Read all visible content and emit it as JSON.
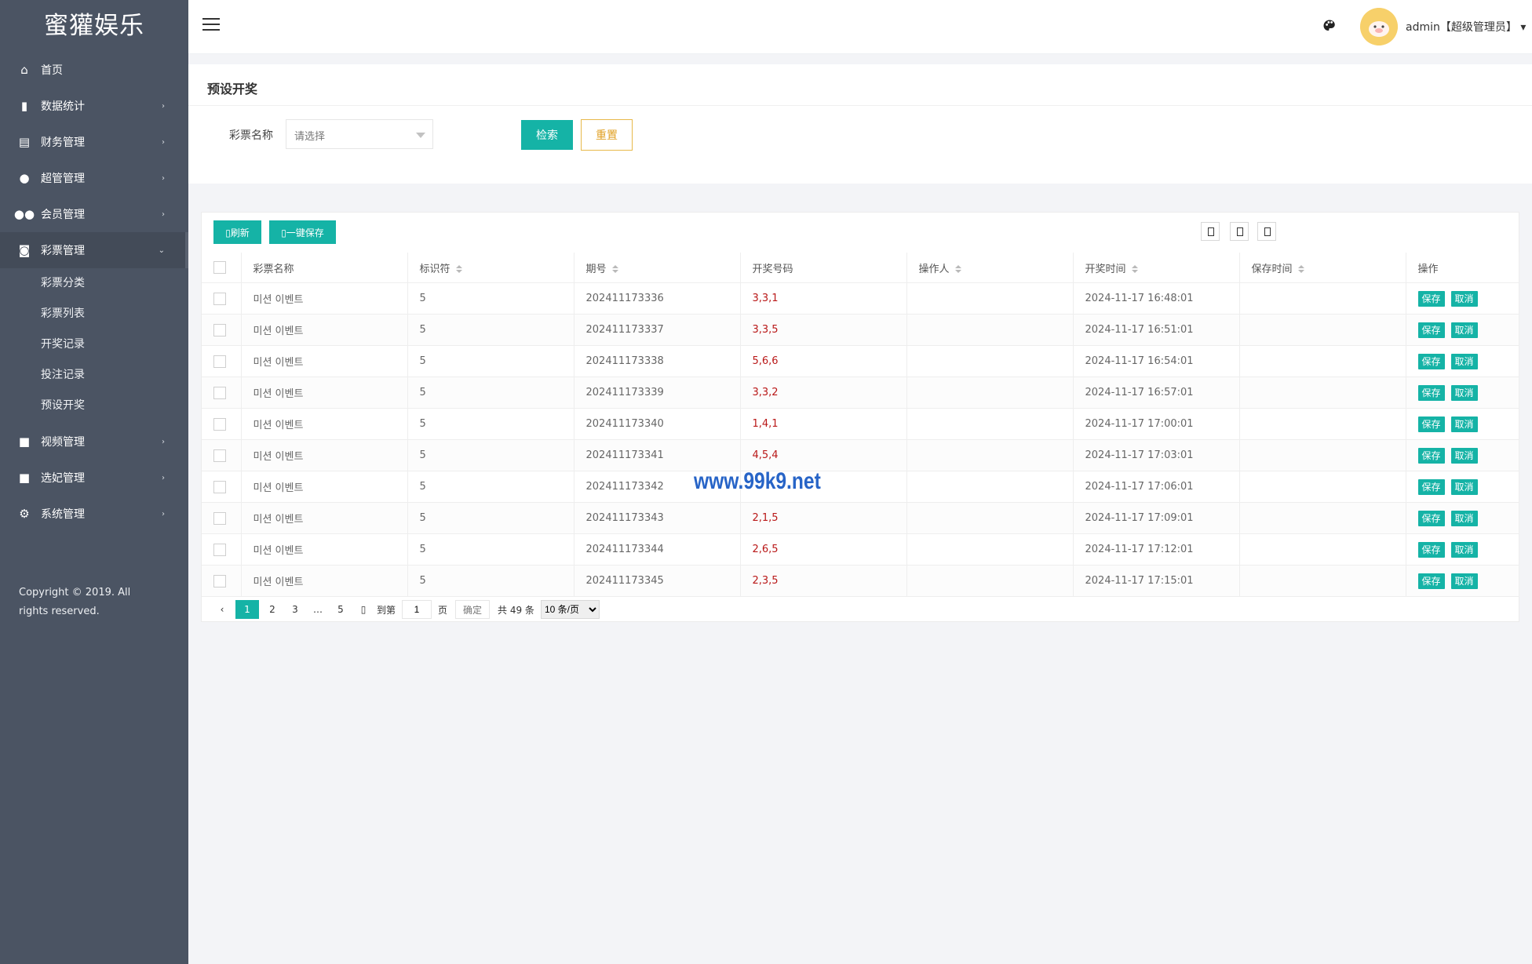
{
  "sidebar": {
    "logo": "蜜獾娱乐",
    "items": [
      {
        "label": "首页",
        "icon": "home-icon",
        "arrow": ""
      },
      {
        "label": "数据统计",
        "icon": "bar-chart-icon",
        "arrow": "›"
      },
      {
        "label": "财务管理",
        "icon": "bank-icon",
        "arrow": "›"
      },
      {
        "label": "超管管理",
        "icon": "user-icon",
        "arrow": "›"
      },
      {
        "label": "会员管理",
        "icon": "users-icon",
        "arrow": "›"
      },
      {
        "label": "彩票管理",
        "icon": "gamepad-icon",
        "arrow": "⌄"
      }
    ],
    "sub_items": [
      "彩票分类",
      "彩票列表",
      "开奖记录",
      "投注记录",
      "预设开奖"
    ],
    "items_after": [
      {
        "label": "视频管理",
        "icon": "video-icon",
        "arrow": "›"
      },
      {
        "label": "选妃管理",
        "icon": "video-icon",
        "arrow": "›"
      },
      {
        "label": "系统管理",
        "icon": "gear-icon",
        "arrow": "›"
      }
    ],
    "copyright": "Copyright © 2019. All rights reserved."
  },
  "topbar": {
    "user": "admin【超级管理员】",
    "user_caret": "▾"
  },
  "search": {
    "title": "预设开奖",
    "field_label": "彩票名称",
    "placeholder": "请选择",
    "search_label": "检索",
    "reset_label": "重置"
  },
  "table": {
    "refresh_label": "刷新",
    "save_all_label": "一键保存",
    "headers": [
      "彩票名称",
      "标识符",
      "期号",
      "开奖号码",
      "操作人",
      "开奖时间",
      "保存时间",
      "操作"
    ],
    "rows": [
      {
        "name": "미션 이벤트",
        "id": "5",
        "issue": "202411173336",
        "numbers": "3,3,1",
        "operator": "",
        "open_time": "2024-11-17 16:48:01",
        "save_time": ""
      },
      {
        "name": "미션 이벤트",
        "id": "5",
        "issue": "202411173337",
        "numbers": "3,3,5",
        "operator": "",
        "open_time": "2024-11-17 16:51:01",
        "save_time": ""
      },
      {
        "name": "미션 이벤트",
        "id": "5",
        "issue": "202411173338",
        "numbers": "5,6,6",
        "operator": "",
        "open_time": "2024-11-17 16:54:01",
        "save_time": ""
      },
      {
        "name": "미션 이벤트",
        "id": "5",
        "issue": "202411173339",
        "numbers": "3,3,2",
        "operator": "",
        "open_time": "2024-11-17 16:57:01",
        "save_time": ""
      },
      {
        "name": "미션 이벤트",
        "id": "5",
        "issue": "202411173340",
        "numbers": "1,4,1",
        "operator": "",
        "open_time": "2024-11-17 17:00:01",
        "save_time": ""
      },
      {
        "name": "미션 이벤트",
        "id": "5",
        "issue": "202411173341",
        "numbers": "4,5,4",
        "operator": "",
        "open_time": "2024-11-17 17:03:01",
        "save_time": ""
      },
      {
        "name": "미션 이벤트",
        "id": "5",
        "issue": "202411173342",
        "numbers": "",
        "operator": "",
        "open_time": "2024-11-17 17:06:01",
        "save_time": ""
      },
      {
        "name": "미션 이벤트",
        "id": "5",
        "issue": "202411173343",
        "numbers": "2,1,5",
        "operator": "",
        "open_time": "2024-11-17 17:09:01",
        "save_time": ""
      },
      {
        "name": "미션 이벤트",
        "id": "5",
        "issue": "202411173344",
        "numbers": "2,6,5",
        "operator": "",
        "open_time": "2024-11-17 17:12:01",
        "save_time": ""
      },
      {
        "name": "미션 이벤트",
        "id": "5",
        "issue": "202411173345",
        "numbers": "2,3,5",
        "operator": "",
        "open_time": "2024-11-17 17:15:01",
        "save_time": ""
      }
    ],
    "save_label": "保存",
    "cancel_label": "取消"
  },
  "pagination": {
    "pages": [
      "1",
      "2",
      "3",
      "…",
      "5"
    ],
    "goto_label": "到第",
    "current_page": "1",
    "page_unit": "页",
    "confirm_label": "确定",
    "total": "共 49 条",
    "page_size": "10 条/页",
    "page_size_options": [
      "10 条/页"
    ]
  },
  "watermark": "www.99k9.net",
  "colors": {
    "sidebar": "#4b5463",
    "accent": "#15b3a6",
    "warning": "#e7b94a",
    "numbers": "#b91818",
    "watermark": "#2764c7"
  }
}
